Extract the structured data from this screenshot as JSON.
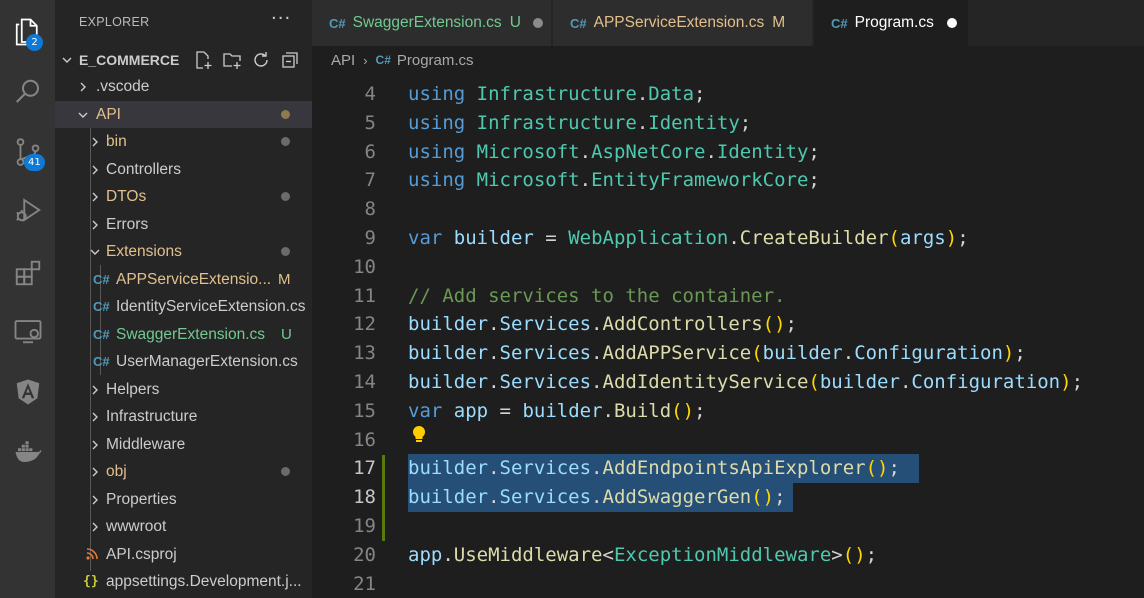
{
  "activity_bar": {
    "items": [
      {
        "icon": "files-icon",
        "badge": "2"
      },
      {
        "icon": "search-icon",
        "badge": ""
      },
      {
        "icon": "source-control-icon",
        "badge": "41"
      },
      {
        "icon": "run-debug-icon",
        "badge": ""
      },
      {
        "icon": "extensions-icon",
        "badge": ""
      },
      {
        "icon": "remote-explorer-icon",
        "badge": ""
      },
      {
        "icon": "angular-icon",
        "badge": ""
      },
      {
        "icon": "docker-icon",
        "badge": ""
      }
    ]
  },
  "explorer": {
    "title": "EXPLORER",
    "more": "···",
    "root": "E_COMMERCE",
    "items": [
      {
        "label": ".vscode",
        "type": "folder",
        "state": "collapsed",
        "color": "#cccccc",
        "marker": ""
      },
      {
        "label": "API",
        "type": "folder",
        "state": "expanded",
        "color": "#e2c08d",
        "marker": "dot"
      },
      {
        "label": "bin",
        "type": "folder",
        "state": "collapsed",
        "color": "#e2c08d",
        "marker": "dot-grey"
      },
      {
        "label": "Controllers",
        "type": "folder",
        "state": "collapsed",
        "color": "#cccccc",
        "marker": ""
      },
      {
        "label": "DTOs",
        "type": "folder",
        "state": "collapsed",
        "color": "#e2c08d",
        "marker": "dot-grey"
      },
      {
        "label": "Errors",
        "type": "folder",
        "state": "collapsed",
        "color": "#cccccc",
        "marker": ""
      },
      {
        "label": "Extensions",
        "type": "folder",
        "state": "expanded",
        "color": "#e2c08d",
        "marker": "dot-grey"
      },
      {
        "label": "APPServiceExtensio...",
        "type": "cs",
        "color": "#e2c08d",
        "marker": "M"
      },
      {
        "label": "IdentityServiceExtension.cs",
        "type": "cs",
        "color": "#cccccc",
        "marker": ""
      },
      {
        "label": "SwaggerExtension.cs",
        "type": "cs",
        "color": "#73c991",
        "marker": "U"
      },
      {
        "label": "UserManagerExtension.cs",
        "type": "cs",
        "color": "#cccccc",
        "marker": ""
      },
      {
        "label": "Helpers",
        "type": "folder",
        "state": "collapsed",
        "color": "#cccccc",
        "marker": ""
      },
      {
        "label": "Infrastructure",
        "type": "folder",
        "state": "collapsed",
        "color": "#cccccc",
        "marker": ""
      },
      {
        "label": "Middleware",
        "type": "folder",
        "state": "collapsed",
        "color": "#cccccc",
        "marker": ""
      },
      {
        "label": "obj",
        "type": "folder",
        "state": "collapsed",
        "color": "#e2c08d",
        "marker": "dot-grey"
      },
      {
        "label": "Properties",
        "type": "folder",
        "state": "collapsed",
        "color": "#cccccc",
        "marker": ""
      },
      {
        "label": "wwwroot",
        "type": "folder",
        "state": "collapsed",
        "color": "#cccccc",
        "marker": ""
      },
      {
        "label": "API.csproj",
        "type": "rss",
        "color": "#cccccc",
        "marker": ""
      },
      {
        "label": "appsettings.Development.j...",
        "type": "json",
        "color": "#cccccc",
        "marker": ""
      }
    ]
  },
  "tabs": [
    {
      "label": "SwaggerExtension.cs",
      "icon": "C#",
      "status": "U",
      "color": "#73c991",
      "dirty": true,
      "active": false
    },
    {
      "label": "APPServiceExtension.cs",
      "icon": "C#",
      "status": "M",
      "color": "#e2c08d",
      "dirty": false,
      "active": false
    },
    {
      "label": "Program.cs",
      "icon": "C#",
      "status": "",
      "color": "#ffffff",
      "dirty": true,
      "active": true
    }
  ],
  "breadcrumb": {
    "folder": "API",
    "separator": "›",
    "icon": "C#",
    "file": "Program.cs"
  },
  "editor": {
    "first_visible_partial": "using                        ",
    "lines": [
      {
        "n": "4",
        "tokens": [
          [
            "k",
            "using"
          ],
          [
            "w",
            " "
          ],
          [
            "t",
            "Infrastructure"
          ],
          [
            "w",
            "."
          ],
          [
            "t",
            "Data"
          ],
          [
            "w",
            ";"
          ]
        ]
      },
      {
        "n": "5",
        "tokens": [
          [
            "k",
            "using"
          ],
          [
            "w",
            " "
          ],
          [
            "t",
            "Infrastructure"
          ],
          [
            "w",
            "."
          ],
          [
            "t",
            "Identity"
          ],
          [
            "w",
            ";"
          ]
        ]
      },
      {
        "n": "6",
        "tokens": [
          [
            "k",
            "using"
          ],
          [
            "w",
            " "
          ],
          [
            "t",
            "Microsoft"
          ],
          [
            "w",
            "."
          ],
          [
            "t",
            "AspNetCore"
          ],
          [
            "w",
            "."
          ],
          [
            "t",
            "Identity"
          ],
          [
            "w",
            ";"
          ]
        ]
      },
      {
        "n": "7",
        "tokens": [
          [
            "k",
            "using"
          ],
          [
            "w",
            " "
          ],
          [
            "t",
            "Microsoft"
          ],
          [
            "w",
            "."
          ],
          [
            "t",
            "EntityFrameworkCore"
          ],
          [
            "w",
            ";"
          ]
        ]
      },
      {
        "n": "8",
        "tokens": []
      },
      {
        "n": "9",
        "tokens": [
          [
            "k",
            "var"
          ],
          [
            "w",
            " "
          ],
          [
            "v",
            "builder"
          ],
          [
            "w",
            " = "
          ],
          [
            "t",
            "WebApplication"
          ],
          [
            "w",
            "."
          ],
          [
            "f",
            "CreateBuilder"
          ],
          [
            "p1",
            "("
          ],
          [
            "v",
            "args"
          ],
          [
            "p1",
            ")"
          ],
          [
            "w",
            ";"
          ]
        ]
      },
      {
        "n": "10",
        "tokens": []
      },
      {
        "n": "11",
        "tokens": [
          [
            "cm",
            "// Add services to the container."
          ]
        ]
      },
      {
        "n": "12",
        "tokens": [
          [
            "v",
            "builder"
          ],
          [
            "w",
            "."
          ],
          [
            "v",
            "Services"
          ],
          [
            "w",
            "."
          ],
          [
            "f",
            "AddControllers"
          ],
          [
            "p1",
            "()"
          ],
          [
            "w",
            ";"
          ]
        ]
      },
      {
        "n": "13",
        "tokens": [
          [
            "v",
            "builder"
          ],
          [
            "w",
            "."
          ],
          [
            "v",
            "Services"
          ],
          [
            "w",
            "."
          ],
          [
            "f",
            "AddAPPService"
          ],
          [
            "p1",
            "("
          ],
          [
            "v",
            "builder"
          ],
          [
            "w",
            "."
          ],
          [
            "v",
            "Configuration"
          ],
          [
            "p1",
            ")"
          ],
          [
            "w",
            ";"
          ]
        ]
      },
      {
        "n": "14",
        "tokens": [
          [
            "v",
            "builder"
          ],
          [
            "w",
            "."
          ],
          [
            "v",
            "Services"
          ],
          [
            "w",
            "."
          ],
          [
            "f",
            "AddIdentityService"
          ],
          [
            "p1",
            "("
          ],
          [
            "v",
            "builder"
          ],
          [
            "w",
            "."
          ],
          [
            "v",
            "Configuration"
          ],
          [
            "p1",
            ")"
          ],
          [
            "w",
            ";"
          ]
        ]
      },
      {
        "n": "15",
        "tokens": [
          [
            "k",
            "var"
          ],
          [
            "w",
            " "
          ],
          [
            "v",
            "app"
          ],
          [
            "w",
            " = "
          ],
          [
            "v",
            "builder"
          ],
          [
            "w",
            "."
          ],
          [
            "f",
            "Build"
          ],
          [
            "p1",
            "()"
          ],
          [
            "w",
            ";"
          ]
        ]
      },
      {
        "n": "16",
        "tokens": []
      },
      {
        "n": "17",
        "tokens": [
          [
            "v",
            "builder"
          ],
          [
            "w",
            "."
          ],
          [
            "v",
            "Services"
          ],
          [
            "w",
            "."
          ],
          [
            "f",
            "AddEndpointsApiExplorer"
          ],
          [
            "p1",
            "()"
          ],
          [
            "w",
            ";"
          ]
        ],
        "selected": true,
        "current": true
      },
      {
        "n": "18",
        "tokens": [
          [
            "v",
            "builder"
          ],
          [
            "w",
            "."
          ],
          [
            "v",
            "Services"
          ],
          [
            "w",
            "."
          ],
          [
            "f",
            "AddSwaggerGen"
          ],
          [
            "p1",
            "()"
          ],
          [
            "w",
            ";"
          ]
        ],
        "selected": true,
        "current": true
      },
      {
        "n": "19",
        "tokens": []
      },
      {
        "n": "20",
        "tokens": [
          [
            "v",
            "app"
          ],
          [
            "w",
            "."
          ],
          [
            "f",
            "UseMiddleware"
          ],
          [
            "w",
            "<"
          ],
          [
            "t",
            "ExceptionMiddleware"
          ],
          [
            "w",
            ">"
          ],
          [
            "p1",
            "()"
          ],
          [
            "w",
            ";"
          ]
        ]
      },
      {
        "n": "21",
        "tokens": []
      }
    ]
  },
  "colors": {
    "activity_bar": "#333333",
    "sidebar": "#252526",
    "editor_bg": "#1e1e1e",
    "selection": "#264f78",
    "badge": "#0e7ad8"
  }
}
